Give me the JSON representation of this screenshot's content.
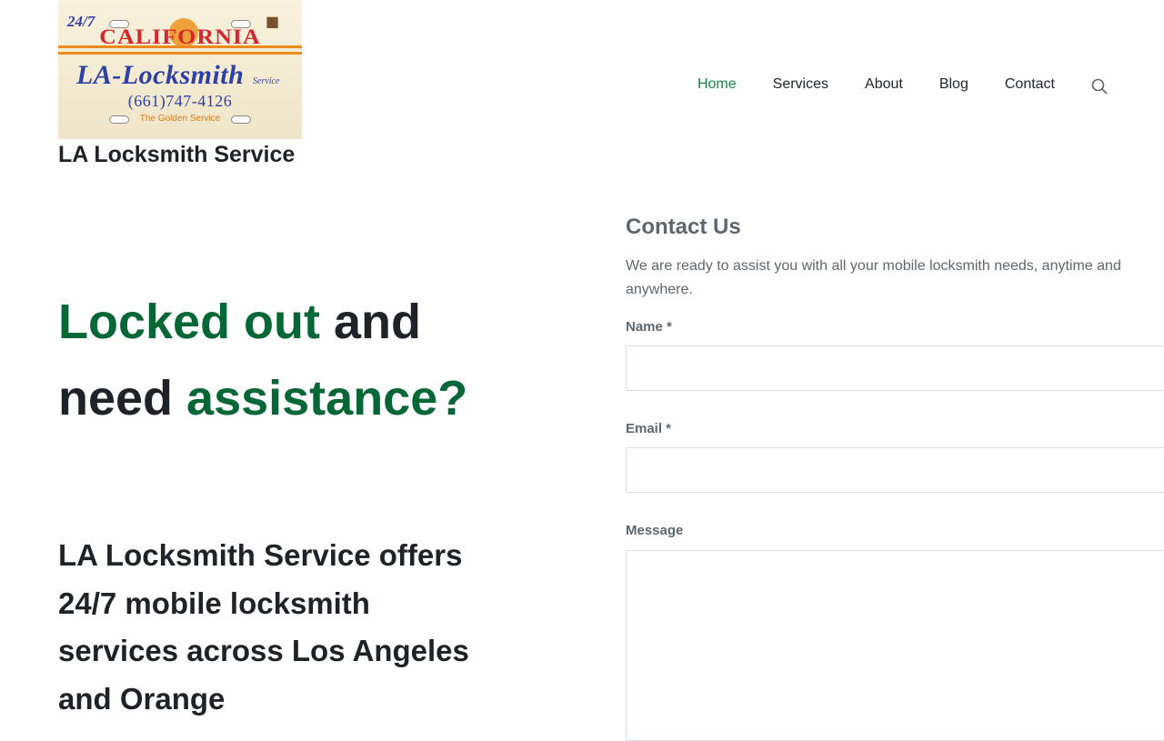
{
  "logo": {
    "hours": "24/7",
    "state": "CALIFORNIA",
    "name": "LA-Locksmith",
    "service": "Service",
    "phone": "(661)747-4126",
    "tagline": "The Golden Service"
  },
  "site": {
    "title": "LA Locksmith Service"
  },
  "nav": {
    "items": [
      "Home",
      "Services",
      "About",
      "Blog",
      "Contact"
    ],
    "active": "Home",
    "search_icon": "search-icon"
  },
  "hero": {
    "heading_part1": "Locked out",
    "heading_part2": " and need ",
    "heading_part3": "assistance?",
    "subheading": "LA Locksmith Service offers 24/7 mobile locksmith services across Los Angeles and Orange"
  },
  "form": {
    "title": "Contact Us",
    "description": "We are ready to assist you with all your mobile locksmith needs, anytime and anywhere.",
    "name_label": "Name *",
    "name_value": "",
    "email_label": "Email *",
    "email_value": "",
    "message_label": "Message",
    "message_value": ""
  },
  "colors": {
    "accent_green": "#046735",
    "nav_active": "#0f8a45",
    "muted_text": "#5f676e"
  }
}
